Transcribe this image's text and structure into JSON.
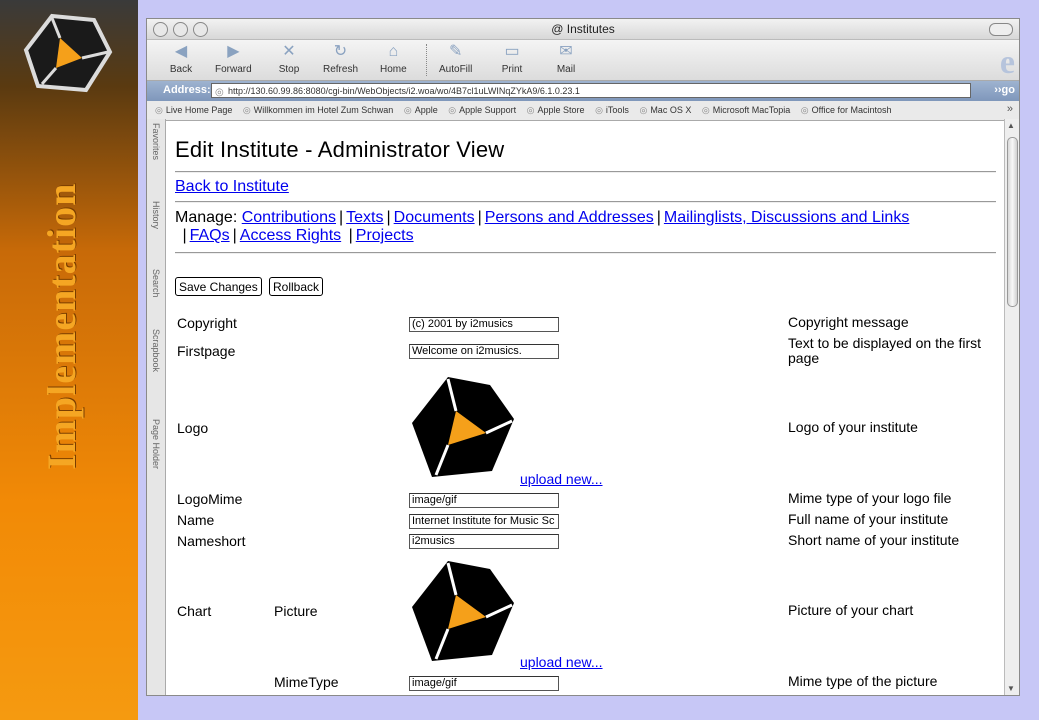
{
  "slide": {
    "title": "Implementation"
  },
  "window": {
    "title": "@ Institutes"
  },
  "toolbar": {
    "back": "Back",
    "forward": "Forward",
    "stop": "Stop",
    "refresh": "Refresh",
    "home": "Home",
    "autofill": "AutoFill",
    "print": "Print",
    "mail": "Mail"
  },
  "address": {
    "label": "Address:",
    "url": "http://130.60.99.86:8080/cgi-bin/WebObjects/i2.woa/wo/4B7cl1uLWINqZYkA9/6.1.0.23.1",
    "go": "go"
  },
  "favorites": [
    "Live Home Page",
    "Willkommen im Hotel Zum Schwan",
    "Apple",
    "Apple Support",
    "Apple Store",
    "iTools",
    "Mac OS X",
    "Microsoft MacTopia",
    "Office for Macintosh"
  ],
  "side_tabs": [
    "Favorites",
    "History",
    "Search",
    "Scrapbook",
    "Page Holder"
  ],
  "page": {
    "title": "Edit Institute - Administrator View",
    "back_link": "Back to Institute",
    "manage_label": "Manage:",
    "manage_links": [
      "Contributions",
      "Texts",
      "Documents",
      "Persons and Addresses",
      "Mailinglists, Discussions and Links",
      "FAQs",
      "Access Rights",
      "Projects"
    ],
    "save_button": "Save Changes",
    "rollback_button": "Rollback",
    "upload_link": "upload new..."
  },
  "rows": {
    "copyright": {
      "label": "Copyright",
      "value": "(c) 2001 by i2musics",
      "desc": "Copyright message"
    },
    "firstpage": {
      "label": "Firstpage",
      "value": "Welcome on i2musics.",
      "desc": "Text to be displayed on the first page"
    },
    "logo": {
      "label": "Logo",
      "desc": "Logo of your institute"
    },
    "logomime": {
      "label": "LogoMime",
      "value": "image/gif",
      "desc": "Mime type of your logo file"
    },
    "name": {
      "label": "Name",
      "value": "Internet Institute for Music Sc",
      "desc": "Full name of your institute"
    },
    "nameshort": {
      "label": "Nameshort",
      "value": "i2musics",
      "desc": "Short name of your institute"
    },
    "chart": {
      "label": "Chart",
      "sub_label": "Picture",
      "desc": "Picture of your chart"
    },
    "mimetype": {
      "label": "MimeType",
      "value": "image/gif",
      "desc": "Mime type of the picture"
    }
  },
  "colors": {
    "link": "#0000ee",
    "logo_orange": "#f5a01a",
    "background": "#c7c7f6"
  }
}
